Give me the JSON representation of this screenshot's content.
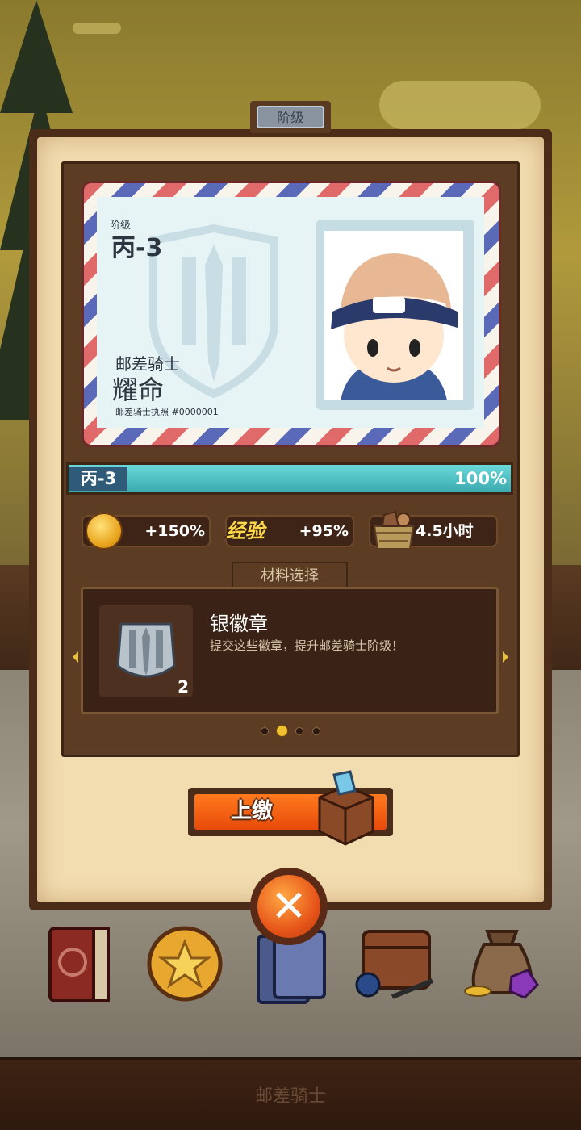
{
  "panel": {
    "title": "阶级"
  },
  "card": {
    "rank_label": "阶级",
    "rank": "丙-3",
    "role": "邮差骑士",
    "name": "耀命",
    "license": "邮差骑士执照 #0000001"
  },
  "progress": {
    "rank": "丙-3",
    "percent_text": "100%",
    "fraction": 1.0
  },
  "stats": [
    {
      "icon": "gold-coin-icon",
      "value": "+150%"
    },
    {
      "icon": "exp-label-icon",
      "label": "经验",
      "value": "+95%"
    },
    {
      "icon": "crate-icon",
      "value": "4.5小时"
    }
  ],
  "materials": {
    "tab_label": "材料选择",
    "item_name": "银徽章",
    "item_desc": "提交这些徽章，提升邮差骑士阶级！",
    "item_count": "2",
    "page_count": 4,
    "active_page": 1
  },
  "submit": {
    "label": "上缴"
  },
  "dock": [
    "book-icon",
    "medal-icon",
    "card-deck-icon",
    "satchel-icon",
    "loot-bag-icon"
  ],
  "footer": {
    "label": "邮差骑士"
  },
  "colors": {
    "accent_orange": "#e8561a",
    "progress_teal": "#3aaab0",
    "panel_brown": "#4a2c18",
    "paper": "#f2ddb0"
  }
}
